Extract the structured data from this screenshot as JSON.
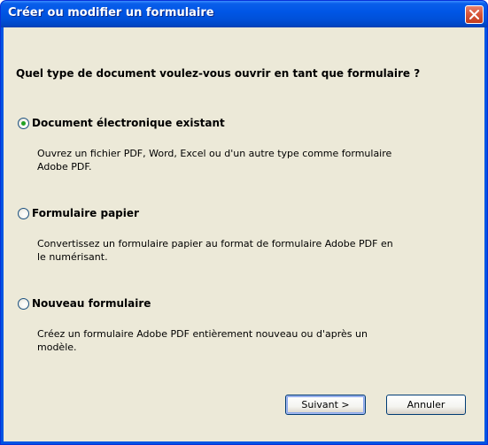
{
  "window": {
    "title": "Créer ou modifier un formulaire"
  },
  "dialog": {
    "question": "Quel type de document voulez-vous ouvrir en tant que formulaire ?",
    "options": [
      {
        "label": "Document électronique existant",
        "selected": true,
        "description_lines": [
          "Ouvrez un fichier PDF, Word, Excel ou d'un autre type comme formulaire",
          "Adobe PDF."
        ]
      },
      {
        "label": "Formulaire papier",
        "selected": false,
        "description_lines": [
          "Convertissez un formulaire papier au format de formulaire Adobe PDF en",
          "le numérisant."
        ]
      },
      {
        "label": "Nouveau formulaire",
        "selected": false,
        "description_lines": [
          "Créez un formulaire Adobe PDF entièrement nouveau ou d'après un",
          "modèle."
        ]
      }
    ],
    "buttons": {
      "next": "Suivant >",
      "cancel": "Annuler"
    }
  },
  "colors": {
    "titlebar": "#0054e3",
    "dialog_bg": "#ece9d8",
    "close_button": "#d8573b",
    "radio_selected_dot": "#21a121"
  }
}
